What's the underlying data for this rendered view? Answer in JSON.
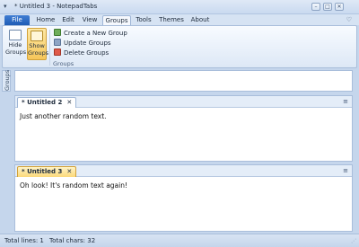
{
  "window": {
    "title": "* Untitled 3 - NotepadTabs",
    "minimize_glyph": "–",
    "maximize_glyph": "□",
    "close_glyph": "✕"
  },
  "menu": {
    "tabs": [
      "File",
      "Home",
      "Edit",
      "View",
      "Groups",
      "Tools",
      "Themes",
      "About"
    ],
    "active": "Groups",
    "help_glyph": "♡"
  },
  "ribbon": {
    "hide_groups_label_1": "Hide",
    "hide_groups_label_2": "Groups",
    "show_groups_label_1": "Show",
    "show_groups_label_2": "Groups",
    "create_group": "Create a  New Group",
    "update_groups": "Update Groups",
    "delete_groups": "Delete  Groups",
    "group_label": "Groups"
  },
  "side_panel": {
    "label": "Groups"
  },
  "documents": [
    {
      "tab": "* Untitled 2",
      "close": "✕",
      "text": "Just another random text.",
      "active": false,
      "menu_glyph": "≡"
    },
    {
      "tab": "* Untitled 3",
      "close": "✕",
      "text": "Oh look! It's random text again!",
      "active": true,
      "menu_glyph": "≡"
    }
  ],
  "status": {
    "total_lines": "Total lines: 1",
    "total_chars": "Total chars: 32"
  },
  "colors": {
    "accent": "#1f5cb5",
    "active_tab": "#fbd97a",
    "chrome": "#c5d6ec"
  }
}
